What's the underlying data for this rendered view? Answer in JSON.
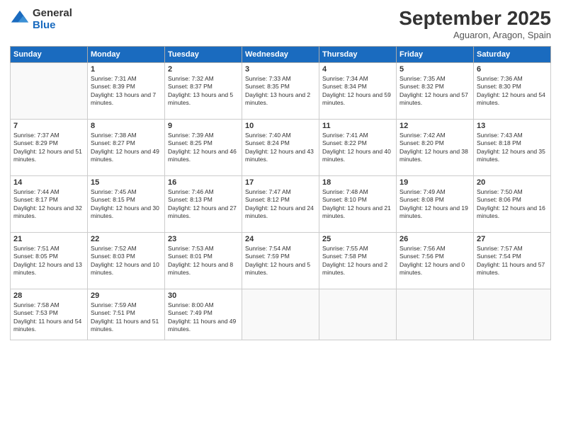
{
  "logo": {
    "line1": "General",
    "line2": "Blue"
  },
  "title": "September 2025",
  "subtitle": "Aguaron, Aragon, Spain",
  "days": [
    "Sunday",
    "Monday",
    "Tuesday",
    "Wednesday",
    "Thursday",
    "Friday",
    "Saturday"
  ],
  "weeks": [
    [
      {
        "num": "",
        "sunrise": "",
        "sunset": "",
        "daylight": ""
      },
      {
        "num": "1",
        "sunrise": "Sunrise: 7:31 AM",
        "sunset": "Sunset: 8:39 PM",
        "daylight": "Daylight: 13 hours and 7 minutes."
      },
      {
        "num": "2",
        "sunrise": "Sunrise: 7:32 AM",
        "sunset": "Sunset: 8:37 PM",
        "daylight": "Daylight: 13 hours and 5 minutes."
      },
      {
        "num": "3",
        "sunrise": "Sunrise: 7:33 AM",
        "sunset": "Sunset: 8:35 PM",
        "daylight": "Daylight: 13 hours and 2 minutes."
      },
      {
        "num": "4",
        "sunrise": "Sunrise: 7:34 AM",
        "sunset": "Sunset: 8:34 PM",
        "daylight": "Daylight: 12 hours and 59 minutes."
      },
      {
        "num": "5",
        "sunrise": "Sunrise: 7:35 AM",
        "sunset": "Sunset: 8:32 PM",
        "daylight": "Daylight: 12 hours and 57 minutes."
      },
      {
        "num": "6",
        "sunrise": "Sunrise: 7:36 AM",
        "sunset": "Sunset: 8:30 PM",
        "daylight": "Daylight: 12 hours and 54 minutes."
      }
    ],
    [
      {
        "num": "7",
        "sunrise": "Sunrise: 7:37 AM",
        "sunset": "Sunset: 8:29 PM",
        "daylight": "Daylight: 12 hours and 51 minutes."
      },
      {
        "num": "8",
        "sunrise": "Sunrise: 7:38 AM",
        "sunset": "Sunset: 8:27 PM",
        "daylight": "Daylight: 12 hours and 49 minutes."
      },
      {
        "num": "9",
        "sunrise": "Sunrise: 7:39 AM",
        "sunset": "Sunset: 8:25 PM",
        "daylight": "Daylight: 12 hours and 46 minutes."
      },
      {
        "num": "10",
        "sunrise": "Sunrise: 7:40 AM",
        "sunset": "Sunset: 8:24 PM",
        "daylight": "Daylight: 12 hours and 43 minutes."
      },
      {
        "num": "11",
        "sunrise": "Sunrise: 7:41 AM",
        "sunset": "Sunset: 8:22 PM",
        "daylight": "Daylight: 12 hours and 40 minutes."
      },
      {
        "num": "12",
        "sunrise": "Sunrise: 7:42 AM",
        "sunset": "Sunset: 8:20 PM",
        "daylight": "Daylight: 12 hours and 38 minutes."
      },
      {
        "num": "13",
        "sunrise": "Sunrise: 7:43 AM",
        "sunset": "Sunset: 8:18 PM",
        "daylight": "Daylight: 12 hours and 35 minutes."
      }
    ],
    [
      {
        "num": "14",
        "sunrise": "Sunrise: 7:44 AM",
        "sunset": "Sunset: 8:17 PM",
        "daylight": "Daylight: 12 hours and 32 minutes."
      },
      {
        "num": "15",
        "sunrise": "Sunrise: 7:45 AM",
        "sunset": "Sunset: 8:15 PM",
        "daylight": "Daylight: 12 hours and 30 minutes."
      },
      {
        "num": "16",
        "sunrise": "Sunrise: 7:46 AM",
        "sunset": "Sunset: 8:13 PM",
        "daylight": "Daylight: 12 hours and 27 minutes."
      },
      {
        "num": "17",
        "sunrise": "Sunrise: 7:47 AM",
        "sunset": "Sunset: 8:12 PM",
        "daylight": "Daylight: 12 hours and 24 minutes."
      },
      {
        "num": "18",
        "sunrise": "Sunrise: 7:48 AM",
        "sunset": "Sunset: 8:10 PM",
        "daylight": "Daylight: 12 hours and 21 minutes."
      },
      {
        "num": "19",
        "sunrise": "Sunrise: 7:49 AM",
        "sunset": "Sunset: 8:08 PM",
        "daylight": "Daylight: 12 hours and 19 minutes."
      },
      {
        "num": "20",
        "sunrise": "Sunrise: 7:50 AM",
        "sunset": "Sunset: 8:06 PM",
        "daylight": "Daylight: 12 hours and 16 minutes."
      }
    ],
    [
      {
        "num": "21",
        "sunrise": "Sunrise: 7:51 AM",
        "sunset": "Sunset: 8:05 PM",
        "daylight": "Daylight: 12 hours and 13 minutes."
      },
      {
        "num": "22",
        "sunrise": "Sunrise: 7:52 AM",
        "sunset": "Sunset: 8:03 PM",
        "daylight": "Daylight: 12 hours and 10 minutes."
      },
      {
        "num": "23",
        "sunrise": "Sunrise: 7:53 AM",
        "sunset": "Sunset: 8:01 PM",
        "daylight": "Daylight: 12 hours and 8 minutes."
      },
      {
        "num": "24",
        "sunrise": "Sunrise: 7:54 AM",
        "sunset": "Sunset: 7:59 PM",
        "daylight": "Daylight: 12 hours and 5 minutes."
      },
      {
        "num": "25",
        "sunrise": "Sunrise: 7:55 AM",
        "sunset": "Sunset: 7:58 PM",
        "daylight": "Daylight: 12 hours and 2 minutes."
      },
      {
        "num": "26",
        "sunrise": "Sunrise: 7:56 AM",
        "sunset": "Sunset: 7:56 PM",
        "daylight": "Daylight: 12 hours and 0 minutes."
      },
      {
        "num": "27",
        "sunrise": "Sunrise: 7:57 AM",
        "sunset": "Sunset: 7:54 PM",
        "daylight": "Daylight: 11 hours and 57 minutes."
      }
    ],
    [
      {
        "num": "28",
        "sunrise": "Sunrise: 7:58 AM",
        "sunset": "Sunset: 7:53 PM",
        "daylight": "Daylight: 11 hours and 54 minutes."
      },
      {
        "num": "29",
        "sunrise": "Sunrise: 7:59 AM",
        "sunset": "Sunset: 7:51 PM",
        "daylight": "Daylight: 11 hours and 51 minutes."
      },
      {
        "num": "30",
        "sunrise": "Sunrise: 8:00 AM",
        "sunset": "Sunset: 7:49 PM",
        "daylight": "Daylight: 11 hours and 49 minutes."
      },
      {
        "num": "",
        "sunrise": "",
        "sunset": "",
        "daylight": ""
      },
      {
        "num": "",
        "sunrise": "",
        "sunset": "",
        "daylight": ""
      },
      {
        "num": "",
        "sunrise": "",
        "sunset": "",
        "daylight": ""
      },
      {
        "num": "",
        "sunrise": "",
        "sunset": "",
        "daylight": ""
      }
    ]
  ]
}
